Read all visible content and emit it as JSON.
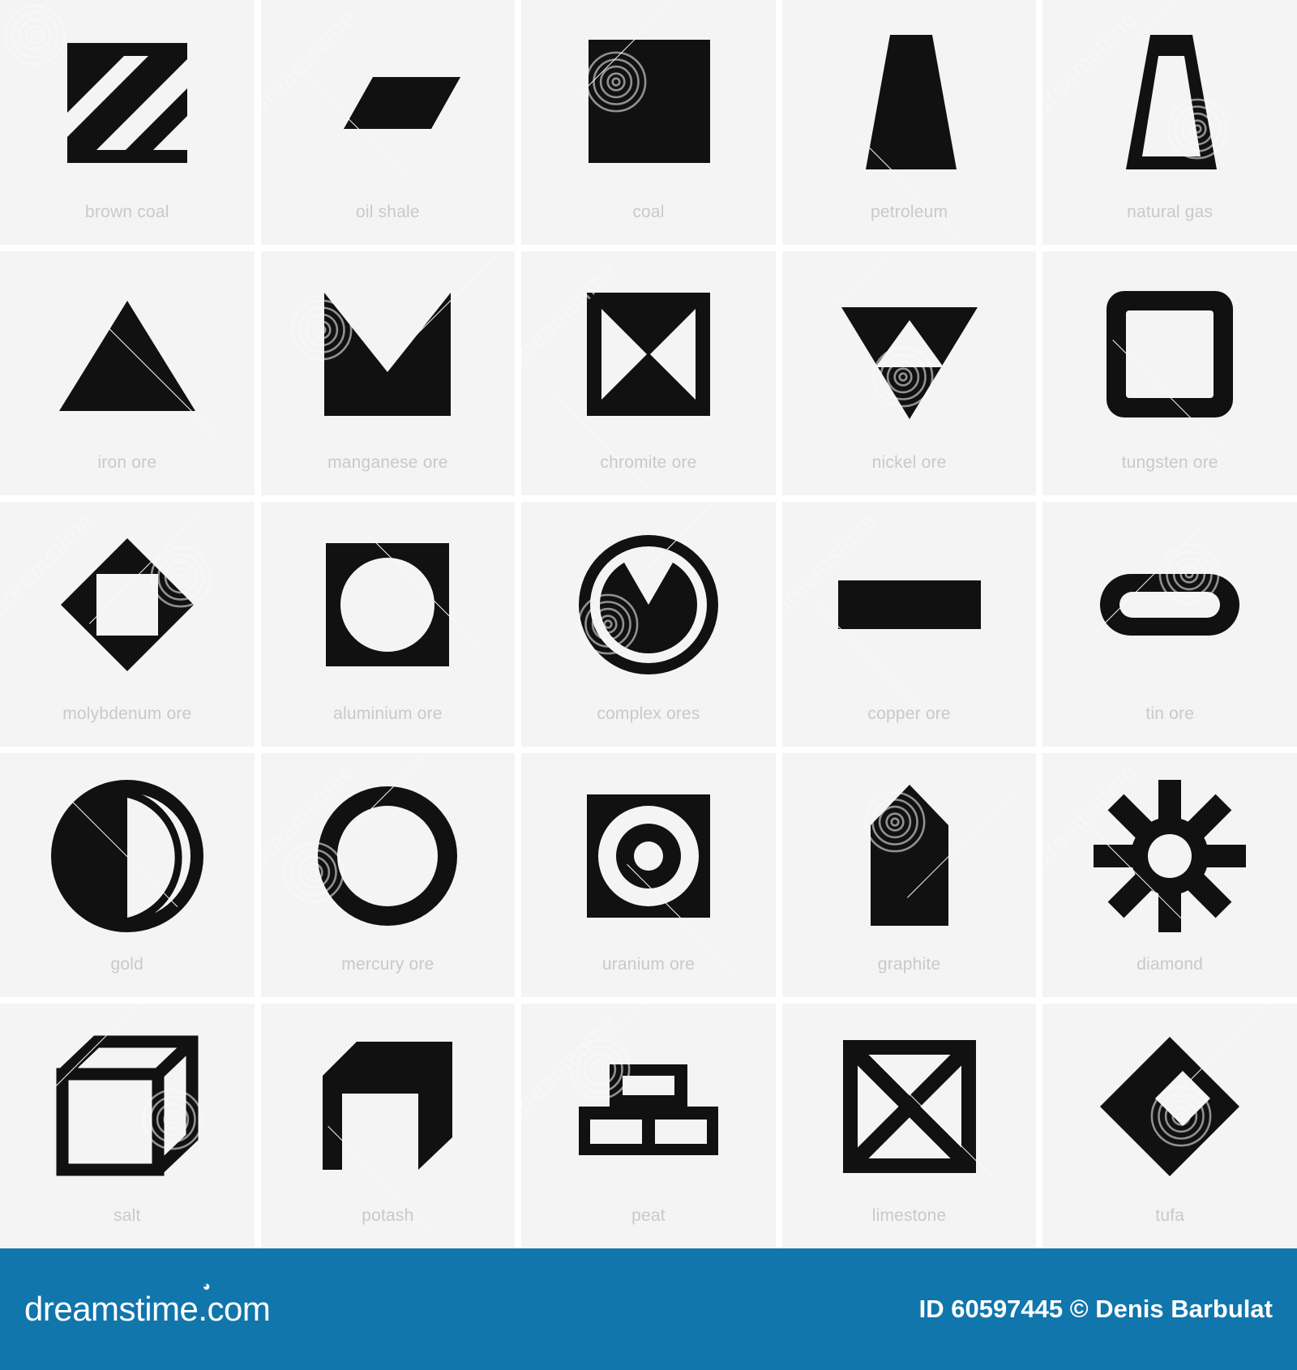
{
  "grid": {
    "columns": 5,
    "rows": 5,
    "cell_background": "#f4f4f4",
    "gap_color": "#ffffff",
    "icon_color": "#111111",
    "label_color": "#c9c9c9",
    "items": [
      {
        "label": "brown coal",
        "icon": "hatched-square-icon"
      },
      {
        "label": "oil shale",
        "icon": "parallelogram-icon"
      },
      {
        "label": "coal",
        "icon": "filled-square-icon"
      },
      {
        "label": "petroleum",
        "icon": "filled-trapezoid-icon"
      },
      {
        "label": "natural gas",
        "icon": "outlined-trapezoid-icon"
      },
      {
        "label": "iron ore",
        "icon": "filled-triangle-icon"
      },
      {
        "label": "manganese ore",
        "icon": "notched-square-icon"
      },
      {
        "label": "chromite ore",
        "icon": "square-bowtie-icon"
      },
      {
        "label": "nickel ore",
        "icon": "down-triangle-cutout-icon"
      },
      {
        "label": "tungsten ore",
        "icon": "rounded-square-outline-icon"
      },
      {
        "label": "molybdenum ore",
        "icon": "diamond-square-cutout-icon"
      },
      {
        "label": "aluminium ore",
        "icon": "square-circle-cutout-icon"
      },
      {
        "label": "complex ores",
        "icon": "fallout-circle-icon"
      },
      {
        "label": "copper ore",
        "icon": "filled-rectangle-icon"
      },
      {
        "label": "tin ore",
        "icon": "pill-outline-icon"
      },
      {
        "label": "gold",
        "icon": "half-filled-circle-icon"
      },
      {
        "label": "mercury ore",
        "icon": "ring-icon"
      },
      {
        "label": "uranium ore",
        "icon": "square-target-icon"
      },
      {
        "label": "graphite",
        "icon": "pentagon-column-icon"
      },
      {
        "label": "diamond",
        "icon": "sunburst-icon"
      },
      {
        "label": "salt",
        "icon": "wireframe-cube-icon"
      },
      {
        "label": "potash",
        "icon": "solid-cube-icon"
      },
      {
        "label": "peat",
        "icon": "brick-wall-icon"
      },
      {
        "label": "limestone",
        "icon": "crossed-square-icon"
      },
      {
        "label": "tufa",
        "icon": "diamond-outline-icon"
      }
    ]
  },
  "footer": {
    "brand": "dreamstime.com",
    "registered_mark": "©",
    "credit": "ID 60597445 © Denis Barbulat",
    "background": "#1076ac"
  },
  "watermark": {
    "text": "dreamstime",
    "color": "#fbfbfb"
  }
}
